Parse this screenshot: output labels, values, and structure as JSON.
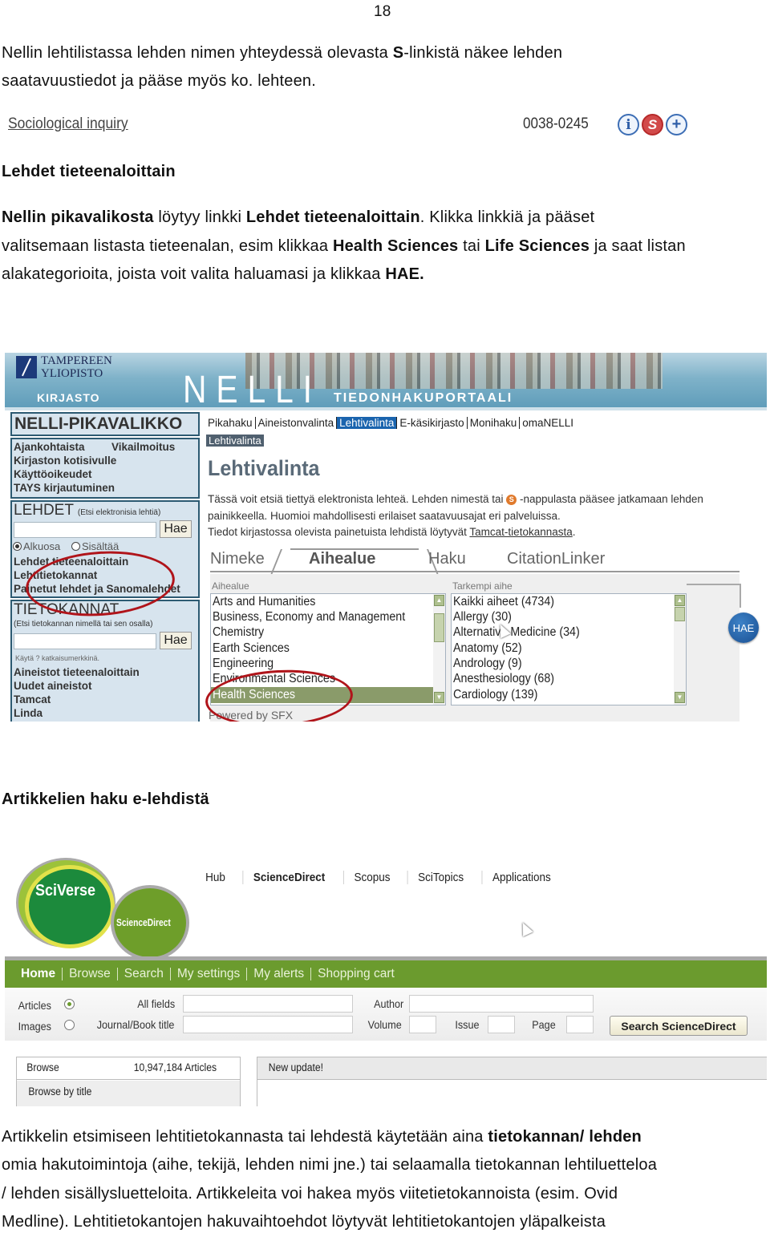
{
  "page_number": "18",
  "intro": {
    "line1_pre": "Nellin lehtilistassa lehden nimen yhteydessä olevasta ",
    "line1_bold": "S",
    "line1_post": "-linkistä näkee lehden",
    "line2": "saatavuustiedot ja pääse myös ko. lehteen."
  },
  "journal_example": {
    "title": "Sociological inquiry",
    "issn": "0038-0245",
    "icons": [
      {
        "name": "info-icon",
        "glyph": "i"
      },
      {
        "name": "sfx-link-icon",
        "glyph": "S"
      },
      {
        "name": "add-icon",
        "glyph": "+"
      }
    ]
  },
  "section1": {
    "heading": "Lehdet tieteenaloittain",
    "p": {
      "b1": "Nellin pikavalikosta",
      "t1": " löytyy linkki ",
      "b2": "Lehdet tieteenaloittain",
      "t2": ".  Klikka linkkiä ja pääset",
      "t3": "valitsemaan listasta tieteenalan, esim klikkaa ",
      "b3": "Health Sciences",
      "t4": " tai ",
      "b4": "Life Sciences",
      "t5": " ja saat listan",
      "t6": "alakategorioita, joista voit valita haluamasi ja klikkaa ",
      "b5": "HAE."
    }
  },
  "nelli": {
    "banner": {
      "university_line1": "TAMPEREEN",
      "university_line2": "YLIOPISTO",
      "kirjasto": "KIRJASTO",
      "logo": "NELLI",
      "subtitle": "TIEDONHAKUPORTAALI"
    },
    "sidebar": {
      "title": "NELLI-PIKAVALIKKO",
      "quick_links": [
        "Ajankohtaista",
        "Vikailmoitus",
        "Kirjaston kotisivulle",
        "Käyttöoikeudet",
        "TAYS kirjautuminen"
      ],
      "lehdet": {
        "heading": "LEHDET",
        "hint": "(Etsi elektronisia lehtiä)",
        "input_value": "",
        "button": "Hae",
        "radio_options": [
          {
            "label": "Alkuosa",
            "selected": true
          },
          {
            "label": "Sisältää",
            "selected": false
          }
        ],
        "links": [
          "Lehdet tieteenaloittain",
          "Lehtitietokannat",
          "Painetut lehdet ja Sanomalehdet"
        ]
      },
      "tietokannat": {
        "heading": "TIETOKANNAT",
        "hint": "(Etsi tietokannan nimellä tai sen osalla)",
        "input_value": "",
        "button": "Hae",
        "tip": "Käytä ? katkaisumerkkinä.",
        "links": [
          "Aineistot tieteenaloittain",
          "Uudet aineistot",
          "Tamcat",
          "Linda"
        ]
      }
    },
    "main": {
      "nav": [
        {
          "label": "Pikahaku",
          "active": false
        },
        {
          "label": "Aineistonvalinta",
          "active": false
        },
        {
          "label": "Lehtivalinta",
          "active": true
        },
        {
          "label": "E-käsikirjasto",
          "active": false
        },
        {
          "label": "Monihaku",
          "active": false
        },
        {
          "label": "omaNELLI",
          "active": false
        }
      ],
      "breadcrumb": "Lehtivalinta",
      "title": "Lehtivalinta",
      "desc_line1_pre": "Tässä voit etsiä tiettyä elektronista lehteä. Lehden nimestä tai ",
      "desc_line1_post": " -nappulasta pääsee jatkamaan lehden",
      "desc_line2": "painikkeella. Huomioi mahdollisesti erilaiset saatavuusajat eri palveluissa.",
      "desc_line3_pre": "Tiedot kirjastossa olevista painetuista lehdistä löytyvät ",
      "desc_line3_link": "Tamcat-tietokannasta",
      "desc_line3_post": ".",
      "tabs": [
        {
          "label": "Nimeke",
          "active": false
        },
        {
          "label": "Aihealue",
          "active": true
        },
        {
          "label": "Haku",
          "active": false
        },
        {
          "label": "CitationLinker",
          "active": false
        }
      ],
      "subject_label": "Aihealue",
      "subjects": [
        {
          "label": "Arts and Humanities",
          "selected": false
        },
        {
          "label": "Business, Economy and Management",
          "selected": false
        },
        {
          "label": "Chemistry",
          "selected": false
        },
        {
          "label": "Earth Sciences",
          "selected": false
        },
        {
          "label": "Engineering",
          "selected": false
        },
        {
          "label": "Environmental Sciences",
          "selected": false
        },
        {
          "label": "Health Sciences",
          "selected": true
        }
      ],
      "subtopic_label": "Tarkempi aihe",
      "subtopics": [
        "Kaikki aiheet (4734)",
        "Allergy (30)",
        "Alternative Medicine (34)",
        "Anatomy (52)",
        "Andrology (9)",
        "Anesthesiology (68)",
        "Cardiology (139)"
      ],
      "search_button": "HAE",
      "powered_by": "Powered by SFX"
    }
  },
  "section2": {
    "heading": "Artikkelien haku e-lehdistä"
  },
  "sciencedirect": {
    "logo_main": "SciVerse",
    "logo_sub": "ScienceDirect",
    "top_nav": [
      {
        "label": "Hub",
        "bold": false
      },
      {
        "label": "ScienceDirect",
        "bold": true
      },
      {
        "label": "Scopus",
        "bold": false
      },
      {
        "label": "SciTopics",
        "bold": false
      },
      {
        "label": "Applications",
        "bold": false
      }
    ],
    "green_nav": [
      {
        "label": "Home",
        "bold": true
      },
      {
        "label": "Browse",
        "bold": false
      },
      {
        "label": "Search",
        "bold": false
      },
      {
        "label": "My settings",
        "bold": false
      },
      {
        "label": "My alerts",
        "bold": false
      },
      {
        "label": "Shopping cart",
        "bold": false
      }
    ],
    "search": {
      "type_options": [
        {
          "label": "Articles",
          "selected": true
        },
        {
          "label": "Images",
          "selected": false
        }
      ],
      "all_fields_label": "All fields",
      "all_fields_value": "",
      "author_label": "Author",
      "author_value": "",
      "journal_label": "Journal/Book title",
      "journal_value": "",
      "volume_label": "Volume",
      "volume_value": "",
      "issue_label": "Issue",
      "issue_value": "",
      "page_label": "Page",
      "page_value": "",
      "button": "Search ScienceDirect"
    },
    "browse": {
      "label": "Browse",
      "count": "10,947,184 Articles",
      "by_title": "Browse by title"
    },
    "update": {
      "label": "New update!"
    }
  },
  "section3": {
    "l1_pre": "Artikkelin etsimiseen lehtitietokannasta tai lehdestä käytetään aina ",
    "l1_bold": "tietokannan/ lehden",
    "l2": "omia hakutoimintoja (aihe, tekijä, lehden nimi jne.) tai selaamalla tietokannan lehtiluetteloa",
    "l3": "/ lehden sisällysluetteloita. Artikkeleita voi hakea myös viitetietokannoista (esim. Ovid",
    "l4": "Medline). Lehtitietokantojen hakuvaihtoehdot löytyvät lehtitietokantojen yläpalkeista"
  },
  "colors": {
    "nelli_sidebar_bg": "#d7e4ee",
    "nelli_active_tab": "#1a64ae",
    "nelli_selected_item": "#8a9b6a",
    "annotation_red": "#b0141a",
    "sd_green": "#6b9b2e",
    "hae_blue": "#1a4f92"
  }
}
